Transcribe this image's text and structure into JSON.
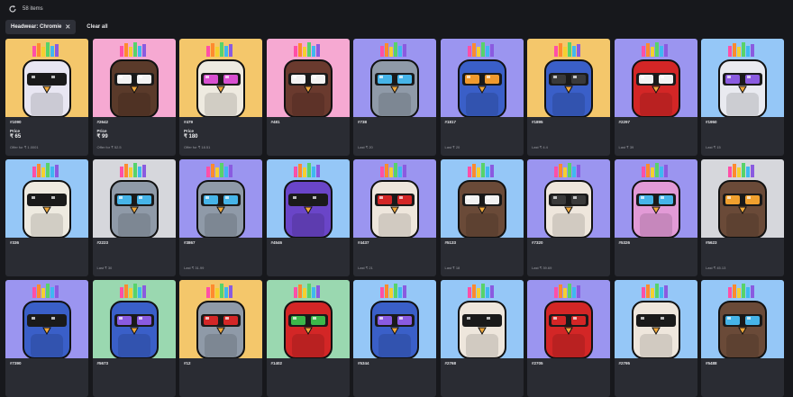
{
  "header": {
    "item_count": "58 items"
  },
  "filters": {
    "active_chip": "Headwear: Chromie",
    "clear_label": "Clear all"
  },
  "price_label": "Price",
  "cards": [
    {
      "id": "#1090",
      "bg": "#f4c76b",
      "body": "#e8e6f2",
      "eye": "#1a1a1a",
      "price": "₹ 65",
      "meta": "Offer for ₹ 1.0001"
    },
    {
      "id": "#2642",
      "bg": "#f6a9d2",
      "body": "#5a3a2a",
      "eye": "#f2f2f2",
      "price": "₹ 99",
      "meta": "Offer for ₹ 52.5"
    },
    {
      "id": "#479",
      "bg": "#f4c76b",
      "body": "#eeeae0",
      "eye": "#d84fd0",
      "price": "₹ 180",
      "meta": "Offer for ₹ 18.51"
    },
    {
      "id": "#481",
      "bg": "#f6a9d2",
      "body": "#6a3a2e",
      "eye": "#f2f2f2",
      "price": "",
      "meta": ""
    },
    {
      "id": "#738",
      "bg": "#9b95f0",
      "body": "#8f9aa8",
      "eye": "#46b4e8",
      "price": "",
      "meta": "Last ₹ 20"
    },
    {
      "id": "#1817",
      "bg": "#9b95f0",
      "body": "#3a5fc8",
      "eye": "#f09a2e",
      "price": "",
      "meta": "Last ₹ 20"
    },
    {
      "id": "#1895",
      "bg": "#f4c76b",
      "body": "#3a5fc8",
      "eye": "#3a3a3a",
      "price": "",
      "meta": "Last ₹ 4.4"
    },
    {
      "id": "#2297",
      "bg": "#9b95f0",
      "body": "#d32626",
      "eye": "#f2f2f2",
      "price": "",
      "meta": "Last ₹ 39"
    },
    {
      "id": "#1950",
      "bg": "#95c7f7",
      "body": "#e9eaf0",
      "eye": "#8a5be0",
      "price": "",
      "meta": "Last ₹ 15"
    },
    {
      "id": "#336",
      "bg": "#95c7f7",
      "body": "#eeeae0",
      "eye": "#1a1a1a",
      "price": "",
      "meta": ""
    },
    {
      "id": "#2223",
      "bg": "#d6d7dc",
      "body": "#8f9aa8",
      "eye": "#46b4e8",
      "price": "",
      "meta": "Last ₹ 30"
    },
    {
      "id": "#3867",
      "bg": "#9b95f0",
      "body": "#8f9aa8",
      "eye": "#46b4e8",
      "price": "",
      "meta": "Last ₹ 31.99"
    },
    {
      "id": "#4546",
      "bg": "#95c7f7",
      "body": "#6a45c8",
      "eye": "#1a1a1a",
      "price": "",
      "meta": ""
    },
    {
      "id": "#4437",
      "bg": "#9b95f0",
      "body": "#eee6dc",
      "eye": "#d32626",
      "price": "",
      "meta": "Last ₹ 21"
    },
    {
      "id": "#5133",
      "bg": "#95c7f7",
      "body": "#6a4a38",
      "eye": "#f2f2f2",
      "price": "",
      "meta": "Last ₹ 18"
    },
    {
      "id": "#7320",
      "bg": "#9b95f0",
      "body": "#eee6dc",
      "eye": "#3a3a3a",
      "price": "",
      "meta": "Last ₹ 39.69"
    },
    {
      "id": "#5326",
      "bg": "#9b95f0",
      "body": "#e29ad6",
      "eye": "#46b4e8",
      "price": "",
      "meta": ""
    },
    {
      "id": "#5623",
      "bg": "#d6d7dc",
      "body": "#6a4a38",
      "eye": "#f0a02e",
      "price": "",
      "meta": "Last ₹ 45.13"
    },
    {
      "id": "#7390",
      "bg": "#9b95f0",
      "body": "#3a5fc8",
      "eye": "#1a1a1a",
      "price": "",
      "meta": ""
    },
    {
      "id": "#5673",
      "bg": "#9ad8b0",
      "body": "#3a5fc8",
      "eye": "#8a5be0",
      "price": "",
      "meta": ""
    },
    {
      "id": "#12",
      "bg": "#f4c76b",
      "body": "#8f9aa8",
      "eye": "#d32626",
      "price": "",
      "meta": ""
    },
    {
      "id": "#1402",
      "bg": "#9ad8b0",
      "body": "#d32626",
      "eye": "#3cb84a",
      "price": "",
      "meta": ""
    },
    {
      "id": "#5344",
      "bg": "#95c7f7",
      "body": "#3a5fc8",
      "eye": "#8a5be0",
      "price": "",
      "meta": ""
    },
    {
      "id": "#2768",
      "bg": "#95c7f7",
      "body": "#eee6dc",
      "eye": "#1a1a1a",
      "price": "",
      "meta": ""
    },
    {
      "id": "#2705",
      "bg": "#9b95f0",
      "body": "#d32626",
      "eye": "#d32626",
      "price": "",
      "meta": ""
    },
    {
      "id": "#2795",
      "bg": "#95c7f7",
      "body": "#eee6dc",
      "eye": "#1a1a1a",
      "price": "",
      "meta": ""
    },
    {
      "id": "#5488",
      "bg": "#95c7f7",
      "body": "#6a4a38",
      "eye": "#46b4e8",
      "price": "",
      "meta": ""
    }
  ]
}
